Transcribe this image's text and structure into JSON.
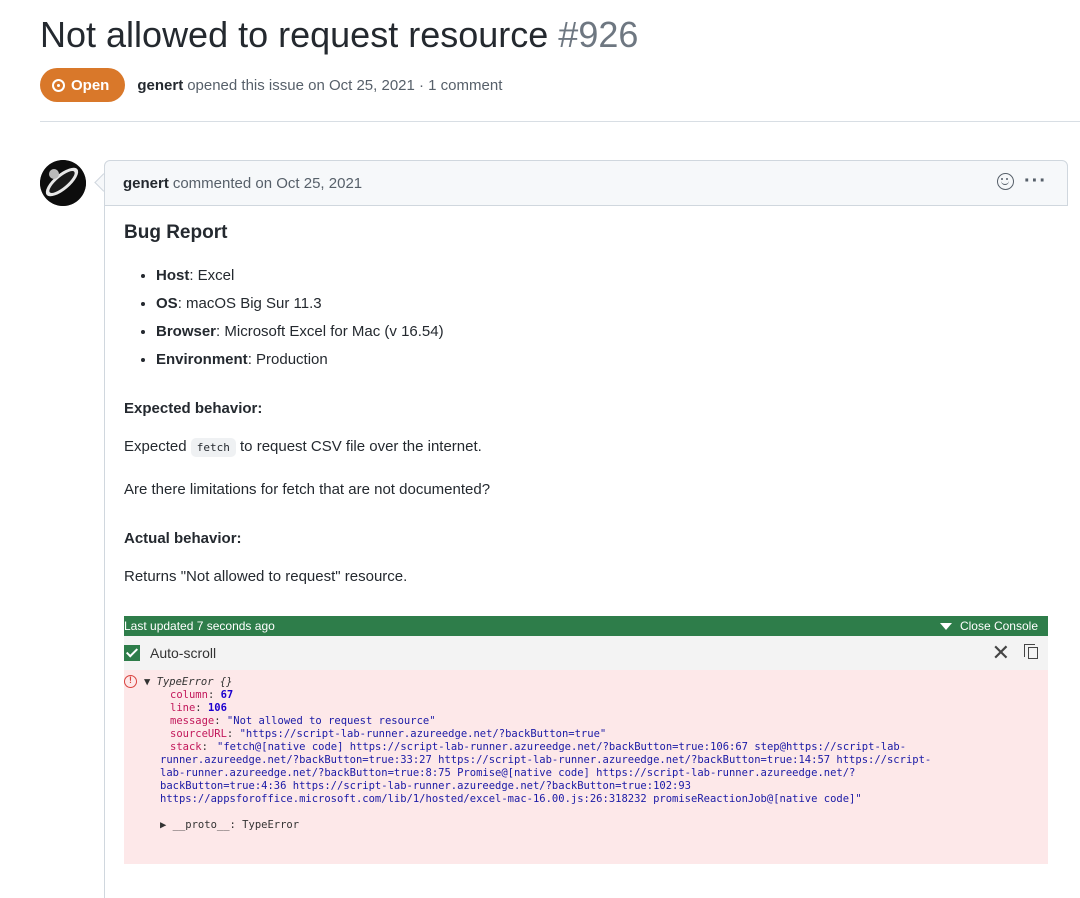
{
  "issue": {
    "title": "Not allowed to request resource",
    "number": "#926",
    "state": "Open",
    "author": "genert",
    "meta_text": "opened this issue on Oct 25, 2021 · 1 comment"
  },
  "comment": {
    "author": "genert",
    "header_text": "commented on Oct 25, 2021",
    "heading": "Bug Report",
    "env": [
      {
        "label": "Host",
        "value": ": Excel"
      },
      {
        "label": "OS",
        "value": ": macOS Big Sur 11.3"
      },
      {
        "label": "Browser",
        "value": ": Microsoft Excel for Mac (v 16.54)"
      },
      {
        "label": "Environment",
        "value": ": Production"
      }
    ],
    "expected_heading": "Expected behavior:",
    "expected_pre": "Expected",
    "expected_code": "fetch",
    "expected_post": "to request CSV file over the internet.",
    "question": "Are there limitations for fetch that are not documented?",
    "actual_heading": "Actual behavior:",
    "actual_text": "Returns \"Not allowed to request\" resource."
  },
  "console": {
    "last_updated": "Last updated 7 seconds ago",
    "close_label": "Close Console",
    "autoscroll_label": "Auto-scroll",
    "error_type": "▼ TypeError {}",
    "column_key": "column",
    "column_val": "67",
    "line_key": "line",
    "line_val": "106",
    "message_key": "message",
    "message_val": "\"Not allowed to request resource\"",
    "sourceurl_key": "sourceURL",
    "sourceurl_val": "\"https://script-lab-runner.azureedge.net/?backButton=true\"",
    "stack_key": "stack",
    "stack_val": "\"fetch@[native code] https://script-lab-runner.azureedge.net/?backButton=true:106:67 step@https://script-lab-\nrunner.azureedge.net/?backButton=true:33:27 https://script-lab-runner.azureedge.net/?backButton=true:14:57 https://script-\nlab-runner.azureedge.net/?backButton=true:8:75 Promise@[native code] https://script-lab-runner.azureedge.net/?\nbackButton=true:4:36 https://script-lab-runner.azureedge.net/?backButton=true:102:93\nhttps://appsforoffice.microsoft.com/lib/1/hosted/excel-mac-16.00.js:26:318232 promiseReactionJob@[native code]\"",
    "proto": "▶ __proto__: TypeError"
  },
  "colors": {
    "open_badge": "#d9782a",
    "console_green": "#2e7d4a",
    "console_error_bg": "#fde8e9"
  }
}
